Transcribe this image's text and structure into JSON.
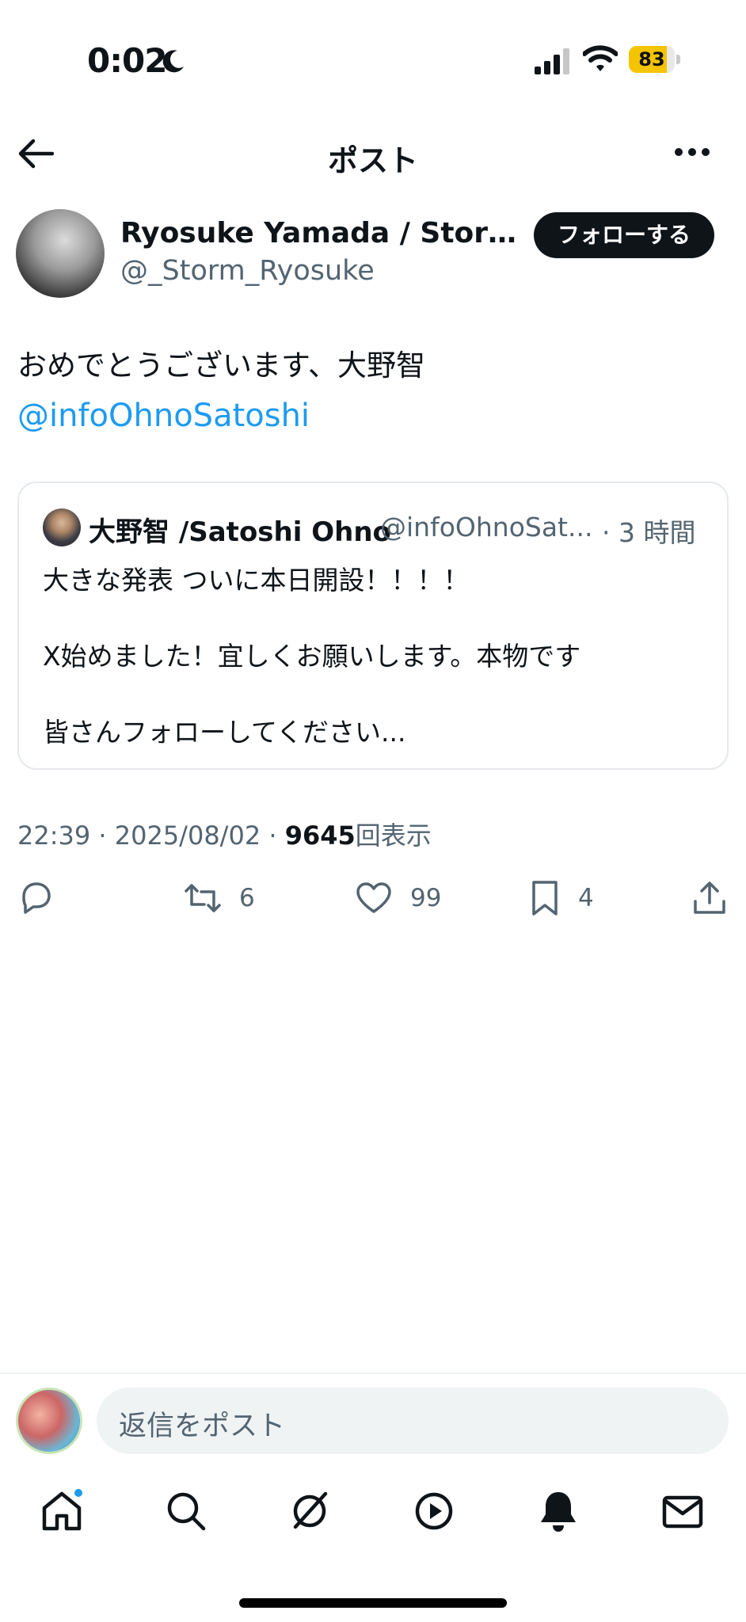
{
  "status_bar": {
    "time": "0:02",
    "battery_level": "83",
    "battery_fraction": 0.83,
    "battery_color": "#f5c400"
  },
  "header": {
    "title": "ポスト",
    "back_icon": "arrow-left-icon",
    "more_icon": "ellipsis-icon"
  },
  "author": {
    "name": "Ryosuke Yamada / Storm L...",
    "handle": "@_Storm_Ryosuke",
    "follow_label": "フォローする"
  },
  "post": {
    "text": "おめでとうございます、大野智",
    "mention": "@infoOhnoSatoshi",
    "mention_color": "#1d9bf0"
  },
  "quote": {
    "name": "大野智 /Satoshi Ohno",
    "handle": "@infoOhnoSat...",
    "time": "· 3 時間",
    "lines": [
      "大きな発表 ついに本日開設！！！！",
      "X始めました！宜しくお願いします。本物です",
      "皆さんフォローしてください..."
    ]
  },
  "meta": {
    "time_date": "22:39 · 2025/08/02 · ",
    "views": "9645",
    "views_label": "回表示"
  },
  "actions": {
    "reply_count": "",
    "retweet_count": "6",
    "like_count": "99",
    "bookmark_count": "4"
  },
  "reply": {
    "placeholder": "返信をポスト"
  },
  "tabbar": {
    "items": [
      "home-icon",
      "search-icon",
      "grok-icon",
      "video-icon",
      "bell-icon",
      "mail-icon"
    ]
  }
}
